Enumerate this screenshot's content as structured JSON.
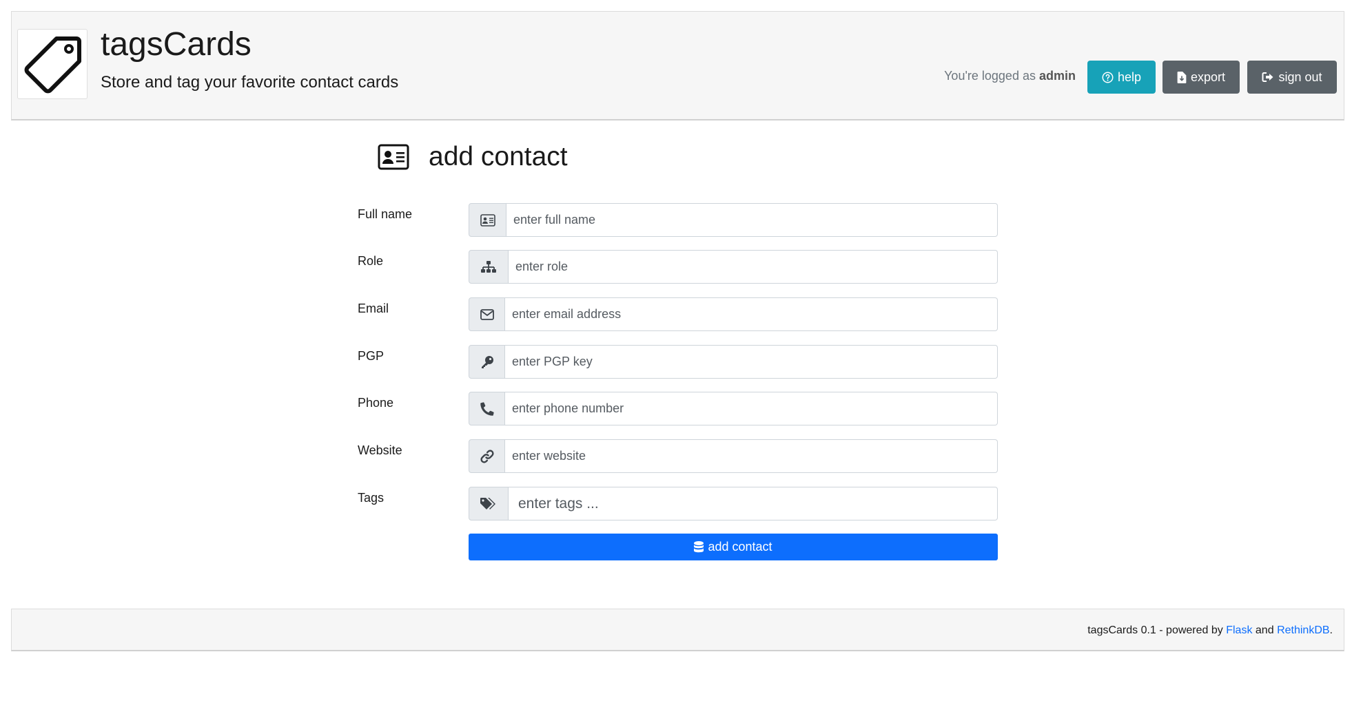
{
  "header": {
    "title": "tagsCards",
    "subtitle": "Store and tag your favorite contact cards",
    "logged_prefix": "You're logged as",
    "username": "admin",
    "buttons": {
      "help": "help",
      "export": "export",
      "sign_out": "sign out"
    }
  },
  "main": {
    "heading": "add contact",
    "fields": [
      {
        "label": "Full name",
        "icon": "id-card-icon",
        "placeholder": "enter full name"
      },
      {
        "label": "Role",
        "icon": "sitemap-icon",
        "placeholder": "enter role"
      },
      {
        "label": "Email",
        "icon": "envelope-icon",
        "placeholder": "enter email address"
      },
      {
        "label": "PGP",
        "icon": "key-icon",
        "placeholder": "enter PGP key"
      },
      {
        "label": "Phone",
        "icon": "phone-icon",
        "placeholder": "enter phone number"
      },
      {
        "label": "Website",
        "icon": "link-icon",
        "placeholder": "enter website"
      },
      {
        "label": "Tags",
        "icon": "tags-icon",
        "placeholder": "enter tags ..."
      }
    ],
    "submit_label": "add contact"
  },
  "footer": {
    "prefix": "tagsCards 0.1 - powered by",
    "link1": "Flask",
    "joiner": "and",
    "link2": "RethinkDB",
    "suffix": "."
  },
  "colors": {
    "help_button": "#17a2b8",
    "secondary_button": "#5a6268",
    "primary_button": "#0d6efd",
    "link": "#0d6efd"
  }
}
